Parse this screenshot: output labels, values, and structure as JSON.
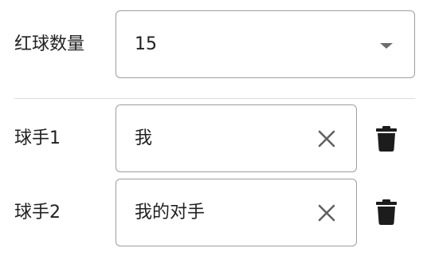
{
  "red_ball_count": {
    "label": "红球数量",
    "value": "15"
  },
  "players": [
    {
      "label": "球手1",
      "value": "我"
    },
    {
      "label": "球手2",
      "value": "我的对手"
    }
  ],
  "icons": {
    "dropdown": "chevron-down-icon",
    "clear": "close-icon",
    "delete": "trash-icon"
  },
  "colors": {
    "text": "#212121",
    "border": "#9e9e9e",
    "icon": "#1c1c1c",
    "clear_icon": "#616161",
    "divider": "#dcdcdc"
  }
}
